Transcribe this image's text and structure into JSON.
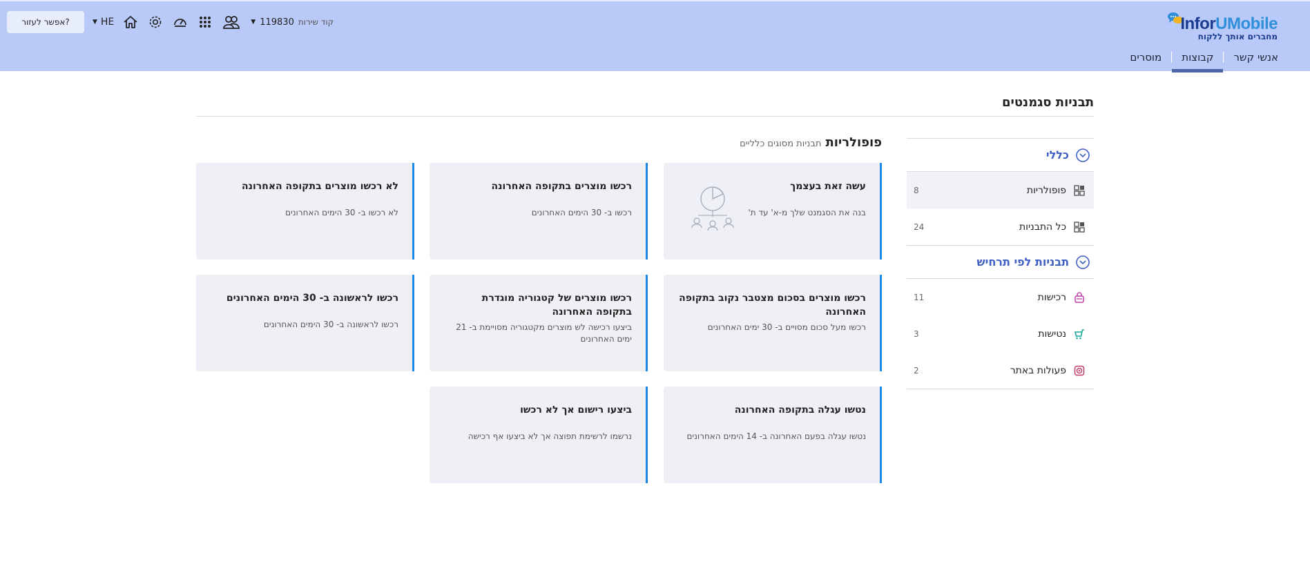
{
  "header": {
    "logo_part1": "Infor",
    "logo_part2": "UMobile",
    "slogan": "מחברים אותך ללקוח",
    "tabs": [
      "אנשי קשר",
      "קבוצות",
      "מוסרים"
    ],
    "active_tab": "קבוצות",
    "service_label": "קוד שירות",
    "service_code": "119830",
    "lang": "HE",
    "help_button": "אפשר לעזור?"
  },
  "page": {
    "title": "תבניות סגמנטים",
    "popular_heading": "פופולריות",
    "popular_subheading": "תבניות מסוגים כלליים"
  },
  "sidebar": {
    "section_general": "כללי",
    "section_scenario": "תבניות לפי תרחיש",
    "items": [
      {
        "label": "פופולריות",
        "count": "8",
        "icon": "grid-icon"
      },
      {
        "label": "כל התבניות",
        "count": "24",
        "icon": "grid-icon"
      },
      {
        "label": "רכישות",
        "count": "11",
        "icon": "shopping-bag-icon"
      },
      {
        "label": "נטישות",
        "count": "3",
        "icon": "cart-icon"
      },
      {
        "label": "פעולות באתר",
        "count": "2",
        "icon": "target-icon"
      }
    ]
  },
  "cards": [
    {
      "title": "עשה זאת בעצמך",
      "desc": "בנה את הסגמנט שלך מ-א' עד ת'"
    },
    {
      "title": "רכשו מוצרים בתקופה האחרונה",
      "desc": "רכשו ב- 30 הימים האחרונים"
    },
    {
      "title": "לא רכשו מוצרים בתקופה האחרונה",
      "desc": "לא רכשו ב- 30 הימים האחרונים"
    },
    {
      "title": "רכשו מוצרים בסכום מצטבר נקוב בתקופה האחרונה",
      "desc": "רכשו מעל סכום מסויים ב- 30 ימים האחרונים"
    },
    {
      "title": "רכשו מוצרים של קטגוריה מוגדרת בתקופה האחרונה",
      "desc": "ביצעו רכישה לש מוצרים מקטגוריה מסויימת ב- 21 ימים האחרונים"
    },
    {
      "title": "רכשו לראשונה ב- 30 הימים האחרונים",
      "desc": "רכשו לראשונה ב- 30 הימים האחרונים"
    },
    {
      "title": "נטשו עגלה בתקופה האחרונה",
      "desc": "נטשו עגלה בפעם האחרונה ב- 14 הימים האחרונים"
    },
    {
      "title": "ביצעו רישום אך לא רכשו",
      "desc": "נרשמו לרשימת תפוצה אך לא ביצעו אף רכישה"
    }
  ],
  "colors": {
    "header_bg": "#b9c9f8",
    "accent": "#3d5fc4",
    "card_border": "#1e88e5",
    "card_bg": "#eef0f5"
  }
}
